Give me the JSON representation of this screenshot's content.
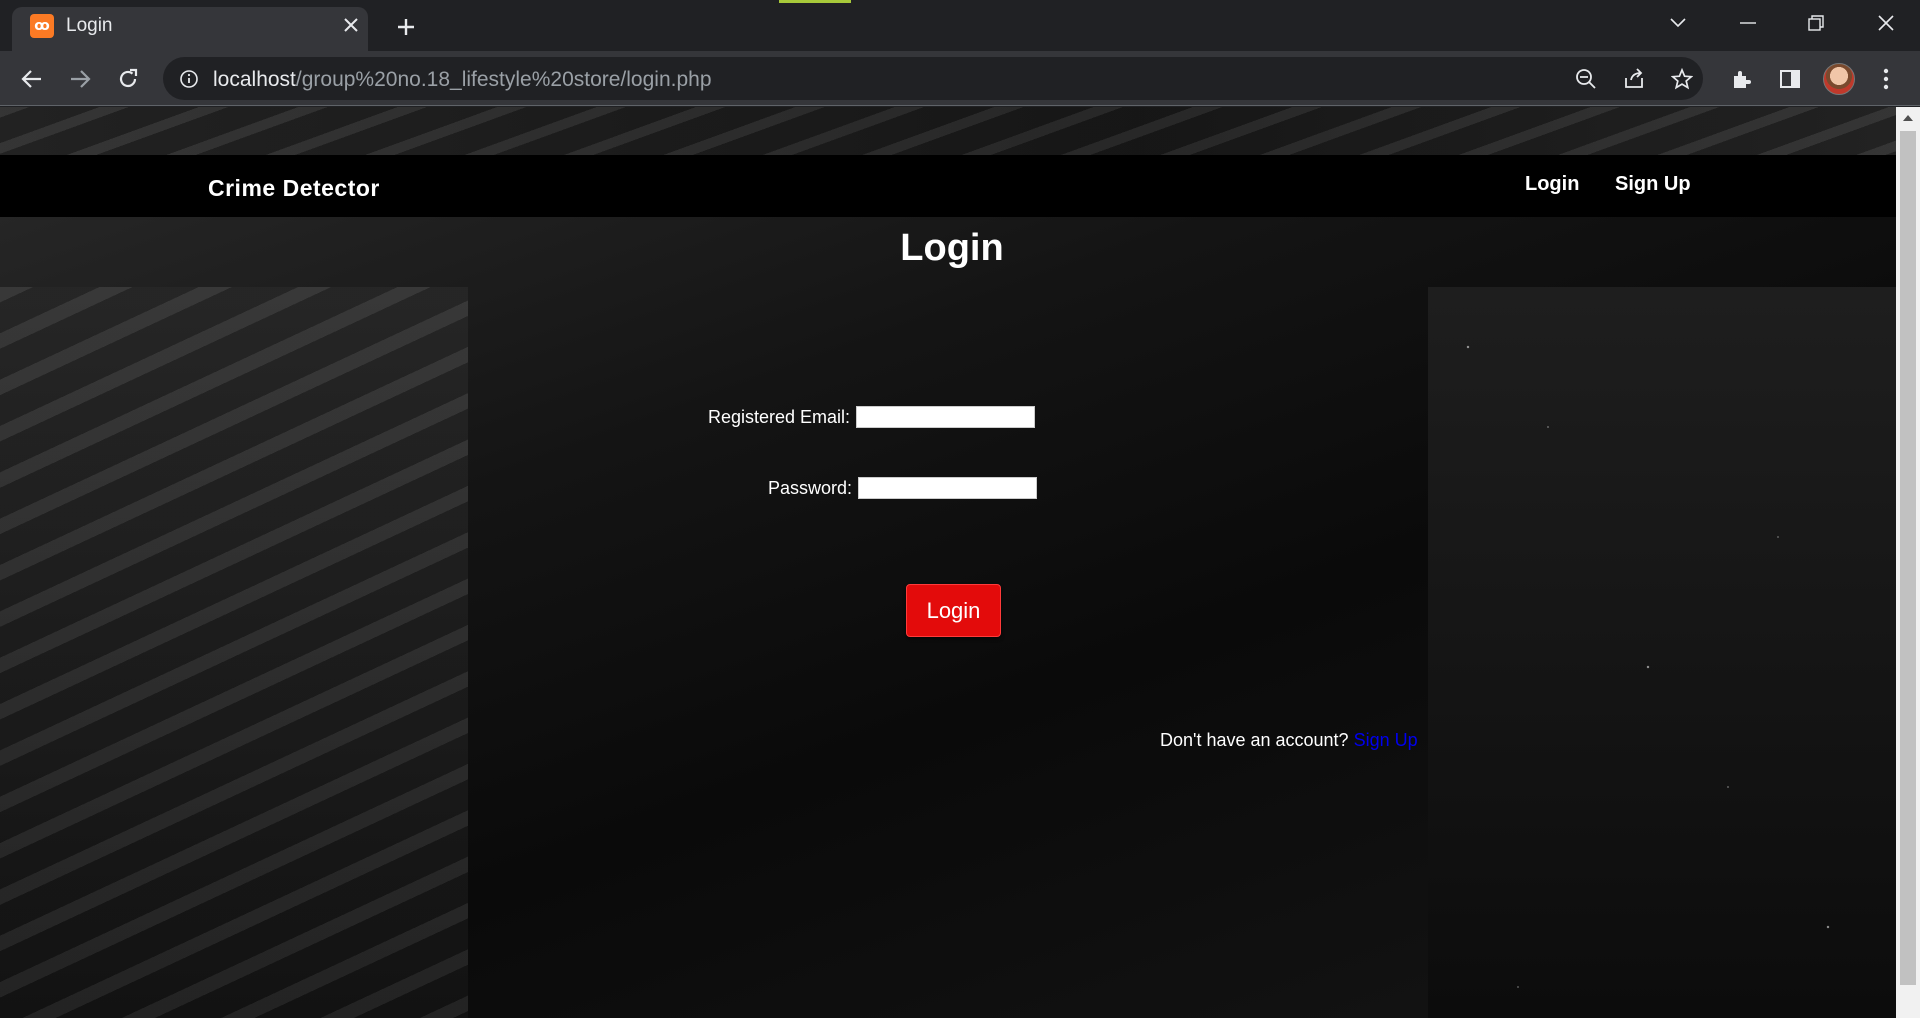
{
  "browser": {
    "tab": {
      "title": "Login",
      "favicon_icon": "xampp-icon",
      "favicon_text": "ꝏ"
    },
    "url": {
      "host": "localhost",
      "path": "/group%20no.18_lifestyle%20store/login.php"
    }
  },
  "navbar": {
    "brand": "Crime Detector",
    "links": [
      {
        "label": "Login"
      },
      {
        "label": "Sign Up"
      }
    ]
  },
  "main": {
    "title": "Login",
    "form": {
      "email_label": "Registered Email:",
      "email_value": "",
      "password_label": "Password:",
      "password_value": "",
      "submit_label": "Login"
    },
    "signup_prompt": "Don't have an account?",
    "signup_link": "Sign Up"
  },
  "colors": {
    "tab_bg": "#35363a",
    "window_bg": "#202124",
    "navbar_bg": "#000000",
    "login_button": "#e30b0b",
    "signup_link": "#0000ee"
  }
}
